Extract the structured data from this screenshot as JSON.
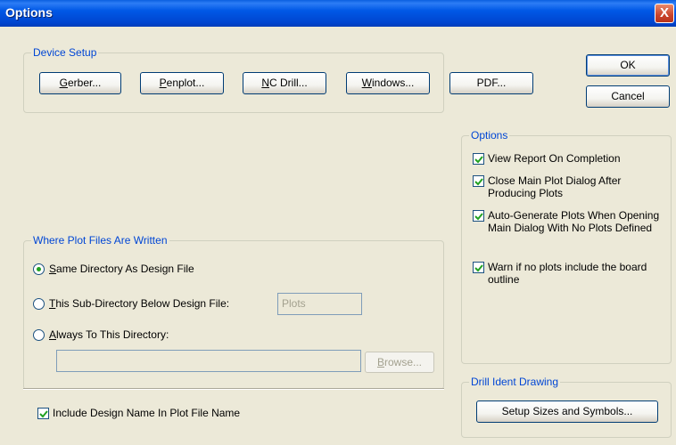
{
  "window": {
    "title": "Options",
    "close_label": "X"
  },
  "device_setup": {
    "legend": "Device Setup",
    "buttons": [
      {
        "mn": "G",
        "rest": "erber..."
      },
      {
        "mn": "P",
        "rest": "enplot..."
      },
      {
        "mn": "N",
        "rest": "C Drill..."
      },
      {
        "mn": "W",
        "rest": "indows..."
      },
      {
        "label": "PDF..."
      }
    ]
  },
  "dialog": {
    "ok_label": "OK",
    "cancel_label": "Cancel"
  },
  "options": {
    "legend": "Options",
    "checks": [
      {
        "label": "View Report On Completion",
        "checked": true
      },
      {
        "label": "Close Main Plot Dialog After Producing Plots",
        "checked": true
      },
      {
        "label": "Auto-Generate Plots When Opening Main Dialog With No Plots Defined",
        "checked": true
      },
      {
        "label": "Warn if no plots include the board outline",
        "checked": true
      }
    ]
  },
  "where_written": {
    "legend": "Where Plot Files Are Written",
    "radios": [
      {
        "mn": "S",
        "rest": "ame Directory As Design File",
        "selected": true
      },
      {
        "mn": "T",
        "rest": "his Sub-Directory Below Design File:",
        "selected": false
      },
      {
        "mn": "A",
        "rest": "lways To This Directory:",
        "selected": false
      }
    ],
    "subdir_value": "Plots",
    "always_dir_value": "",
    "browse": {
      "mn": "B",
      "rest": "rowse..."
    }
  },
  "include_name": {
    "label": "Include Design Name In Plot File Name",
    "checked": true
  },
  "drill": {
    "legend": "Drill Ident Drawing",
    "button_label": "Setup Sizes and Symbols..."
  }
}
